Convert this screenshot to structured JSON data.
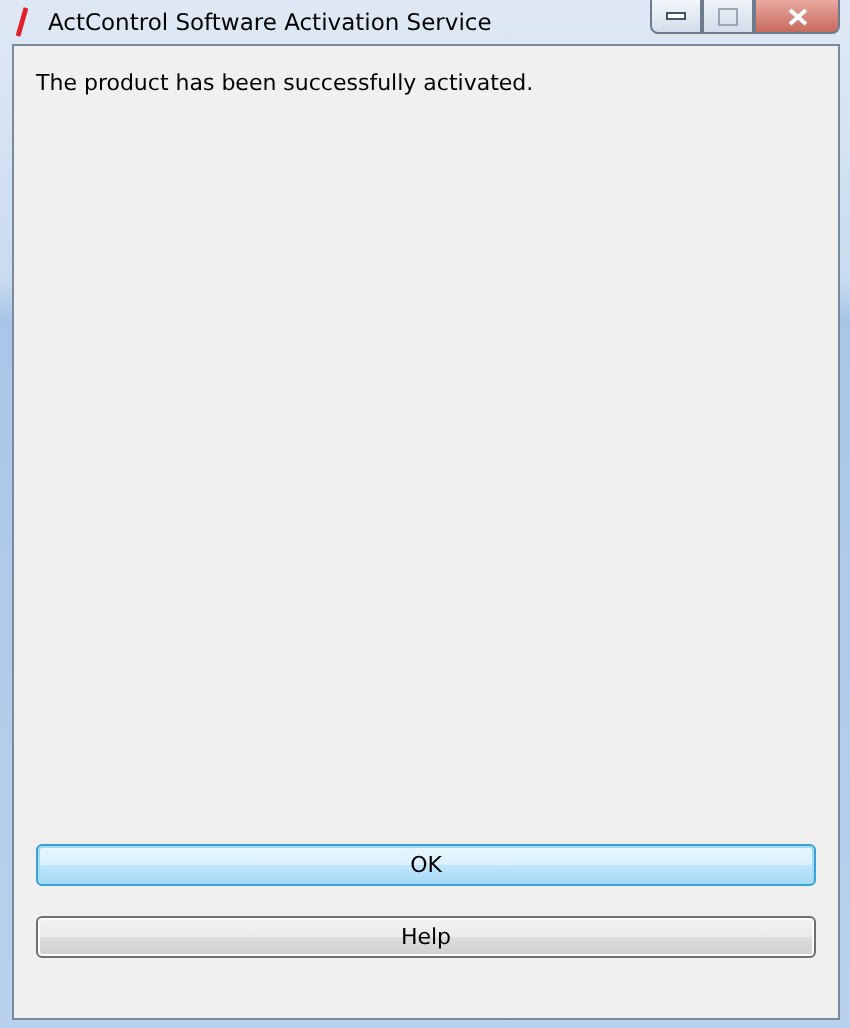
{
  "window": {
    "title": "ActControl Software Activation Service"
  },
  "message": "The product has been successfully activated.",
  "buttons": [
    {
      "label": "OK",
      "focused": true
    },
    {
      "label": "Help",
      "focused": false
    }
  ]
}
